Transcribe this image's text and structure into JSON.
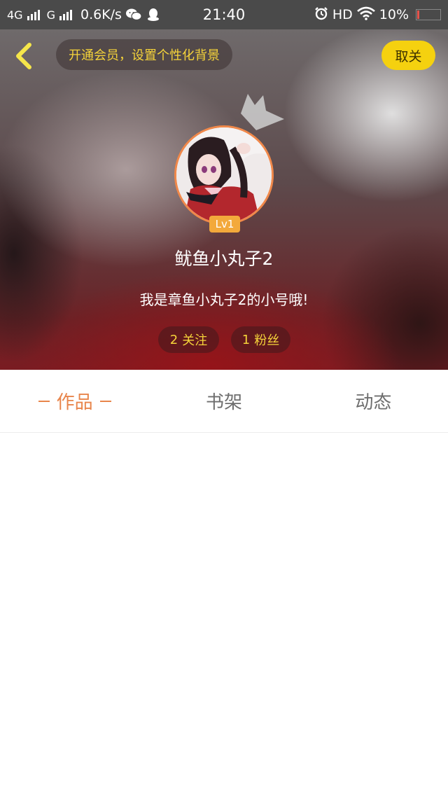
{
  "status_bar": {
    "network1": "4G",
    "network2": "G",
    "speed": "0.6K/s",
    "time": "21:40",
    "hd": "HD",
    "battery": "10%",
    "battery_level": 0.1,
    "icons": [
      "signal-bars-icon",
      "wechat-icon",
      "qq-icon",
      "alarm-icon",
      "wifi-icon",
      "battery-icon"
    ]
  },
  "header": {
    "vip_banner": "开通会员，设置个性化背景",
    "unfollow_label": "取关",
    "level": "Lv1",
    "username": "鱿鱼小丸子2",
    "bio": "我是章鱼小丸子2的小号哦!",
    "stats": [
      {
        "count": "2",
        "label": "关注"
      },
      {
        "count": "1",
        "label": "粉丝"
      }
    ]
  },
  "tabs": [
    {
      "label": "作品",
      "active": true
    },
    {
      "label": "书架",
      "active": false
    },
    {
      "label": "动态",
      "active": false
    }
  ],
  "colors": {
    "accent": "#e8854b",
    "vip_text": "#f5d33a",
    "unfollow_bg": "#f5d10f",
    "level_bg": "#f3a93b",
    "status_bar_bg": "#4a4a4a"
  }
}
